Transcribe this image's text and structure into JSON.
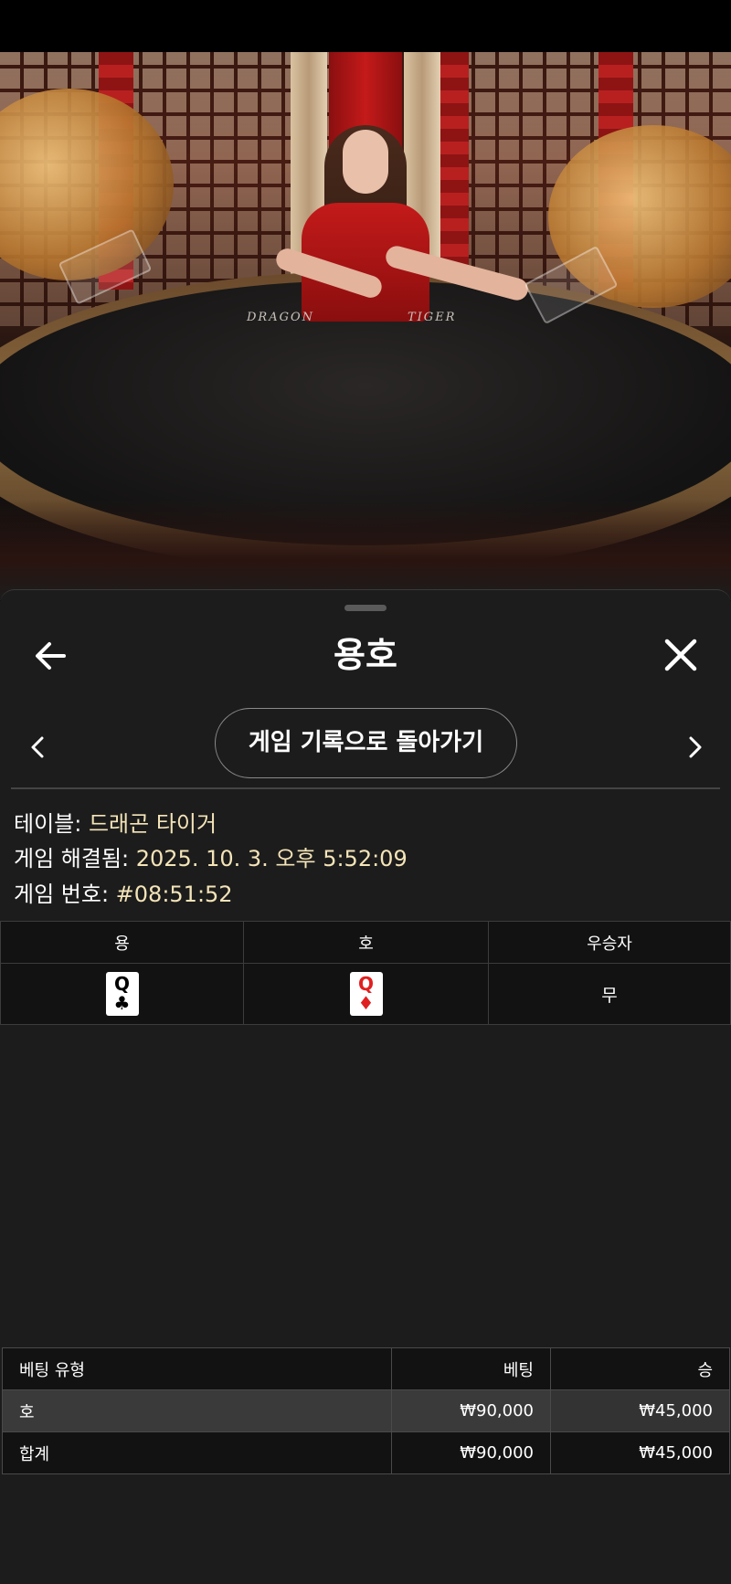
{
  "header": {
    "title": "용호",
    "history_button": "게임 기록으로 돌아가기"
  },
  "stream": {
    "table_labels": [
      "DRAGON",
      "TIGER"
    ]
  },
  "info": {
    "table_label": "테이블: ",
    "table_value": "드래곤 타이거",
    "resolved_label": "게임 해결됨: ",
    "resolved_value": "2025. 10. 3. 오후 5:52:09",
    "round_label": "게임 번호: ",
    "round_value": "#08:51:52"
  },
  "result": {
    "columns": [
      "용",
      "호",
      "우승자"
    ],
    "dragon_card": {
      "rank": "Q",
      "suit": "♣",
      "color": "#000000"
    },
    "tiger_card": {
      "rank": "Q",
      "suit": "♦",
      "color": "#e02020"
    },
    "winner": "무"
  },
  "bets": {
    "columns": [
      "베팅 유형",
      "베팅",
      "승"
    ],
    "rows": [
      {
        "type": "호",
        "bet": "₩90,000",
        "win": "₩45,000"
      }
    ],
    "total": {
      "type": "합계",
      "bet": "₩90,000",
      "win": "₩45,000"
    }
  },
  "colors": {
    "sheet_background": "#1c1c1c",
    "info_value": "#f4e4b8",
    "table_header": "#121212",
    "bet_row": "#3a3a3a"
  }
}
